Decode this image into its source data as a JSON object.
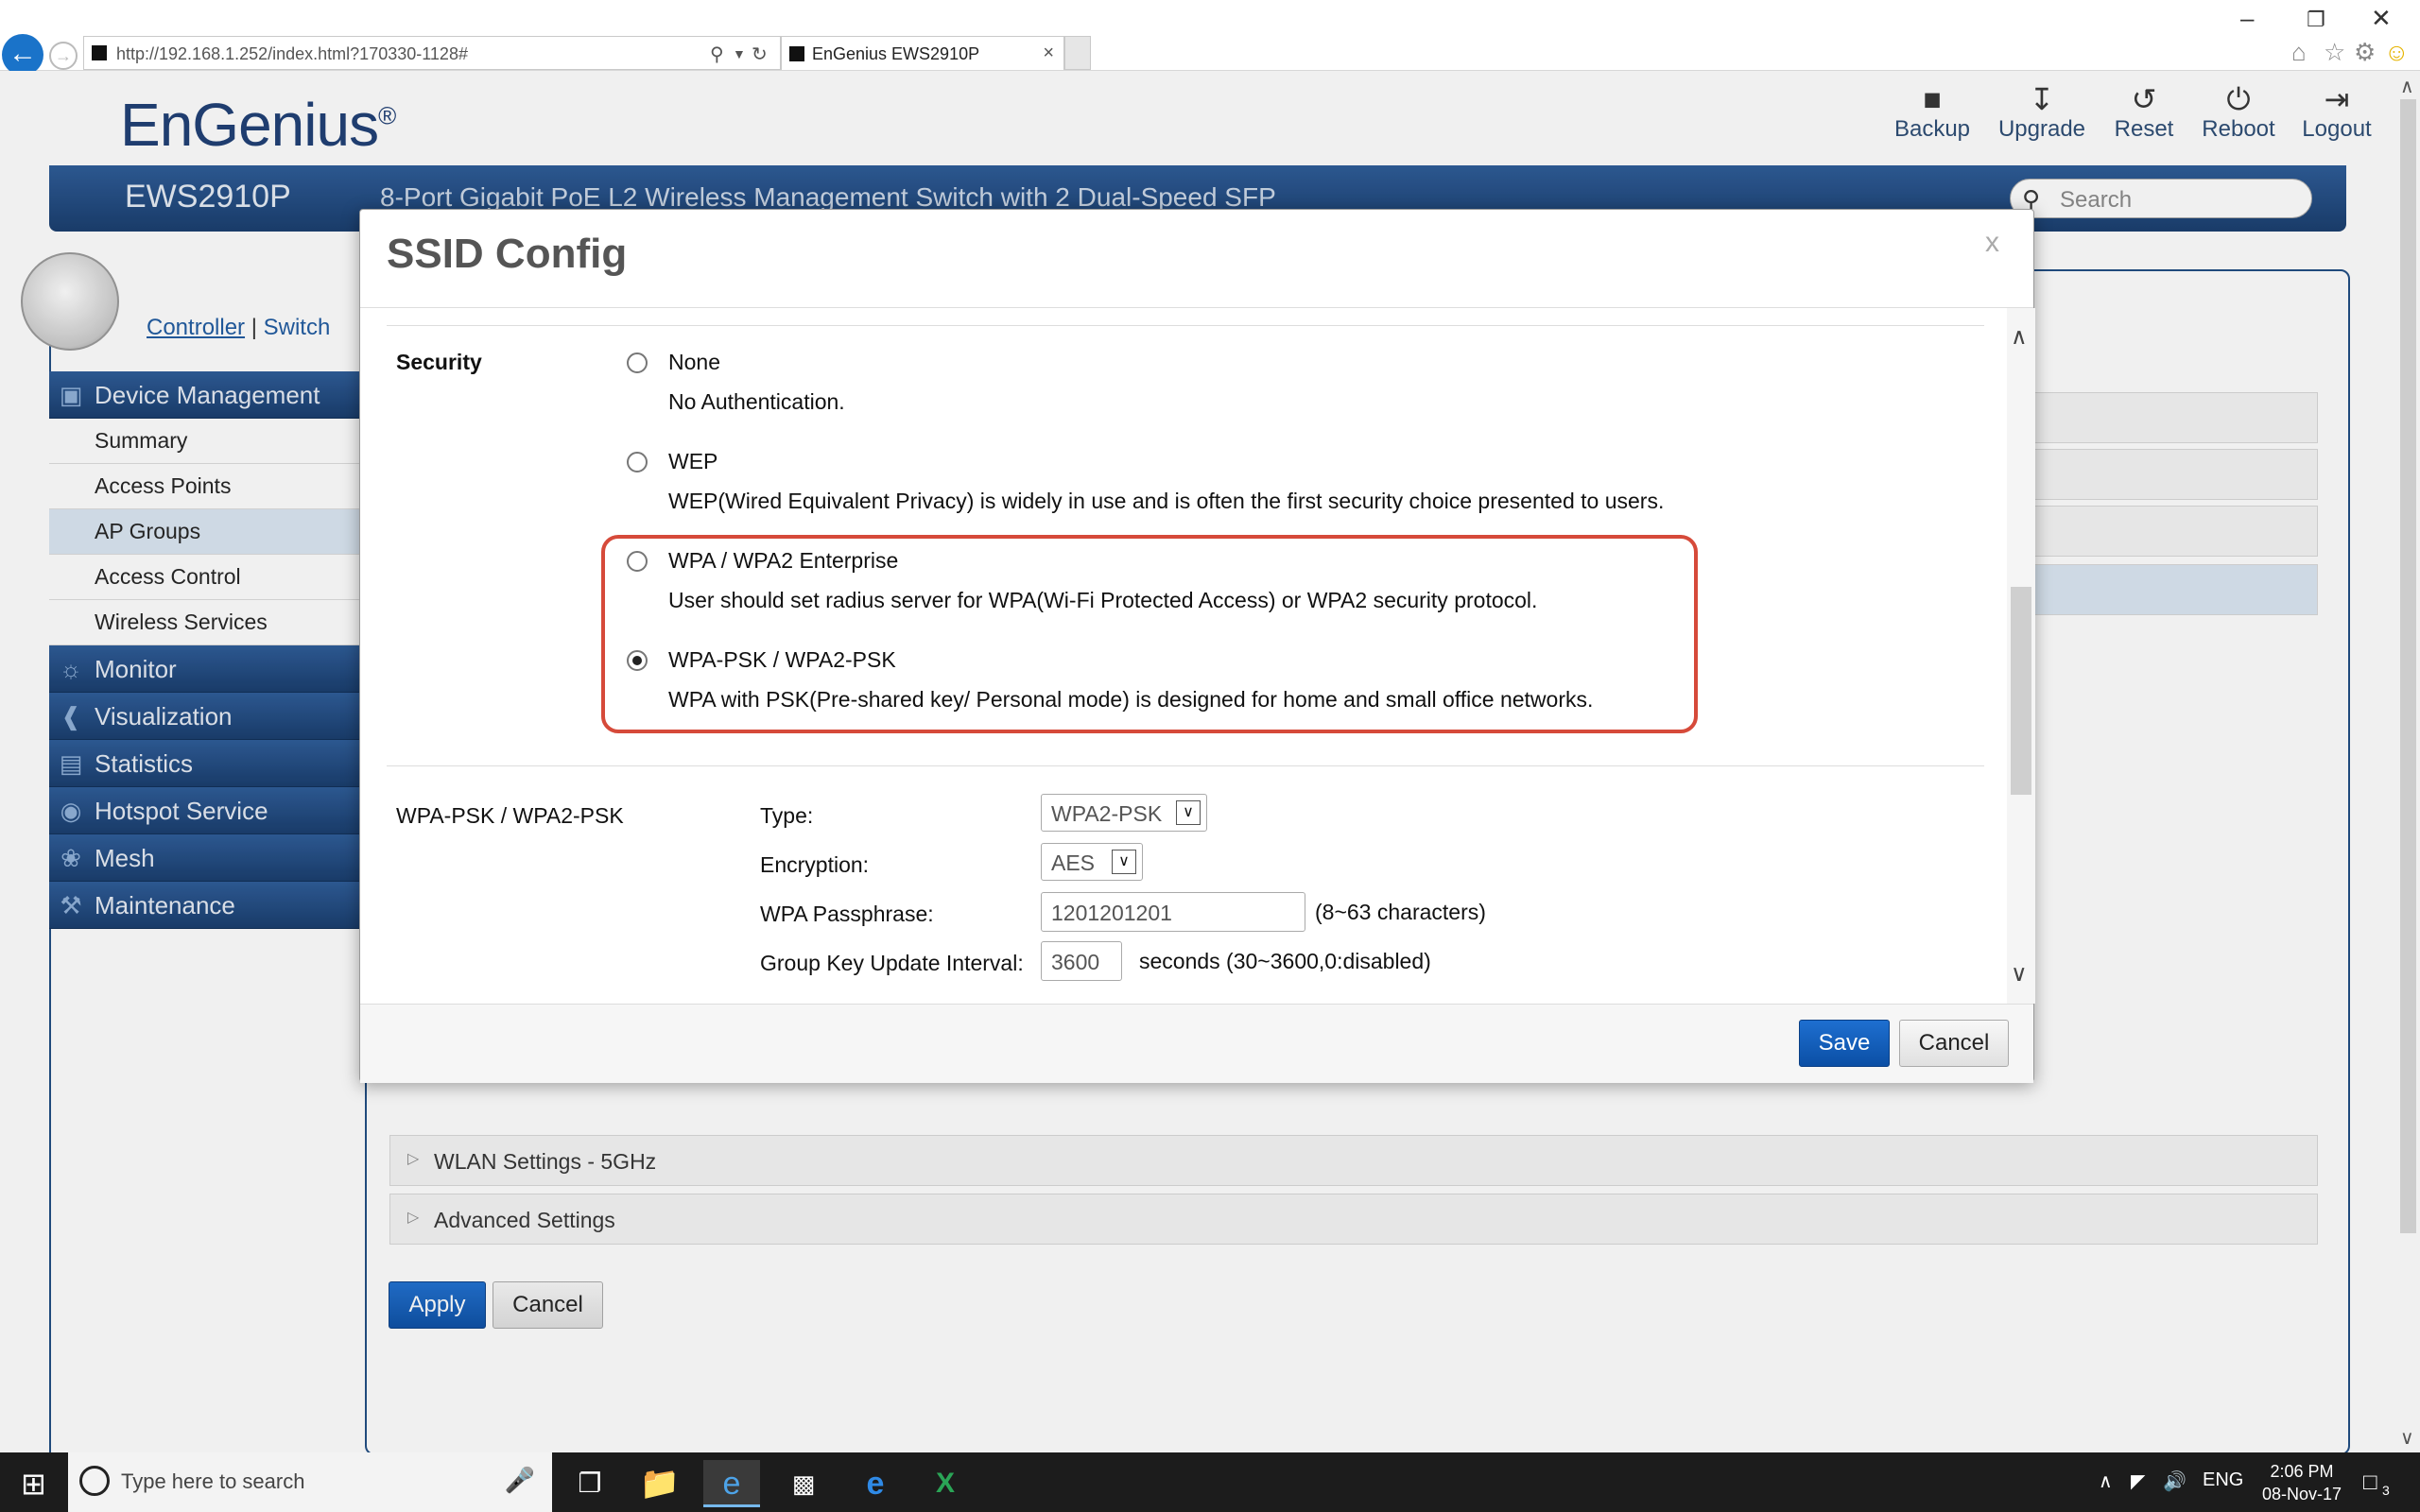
{
  "browser": {
    "url": "http://192.168.1.252/index.html?170330-1128#",
    "tab_title": "EnGenius EWS2910P"
  },
  "header": {
    "logo": "EnGenius",
    "model": "EWS2910P",
    "subtitle": "8-Port Gigabit PoE L2 Wireless Management Switch with 2 Dual-Speed SFP",
    "search_placeholder": "Search",
    "actions": [
      {
        "label": "Backup",
        "icon": "save-icon"
      },
      {
        "label": "Upgrade",
        "icon": "download-icon"
      },
      {
        "label": "Reset",
        "icon": "reset-icon"
      },
      {
        "label": "Reboot",
        "icon": "power-icon"
      },
      {
        "label": "Logout",
        "icon": "logout-icon"
      }
    ]
  },
  "sidebar": {
    "controller": "Controller",
    "sep": "|",
    "switch": "Switch",
    "sections": [
      {
        "label": "Device Management",
        "icon": "device-icon"
      },
      {
        "label": "Monitor",
        "icon": "monitor-icon"
      },
      {
        "label": "Visualization",
        "icon": "share-icon"
      },
      {
        "label": "Statistics",
        "icon": "bar-chart-icon"
      },
      {
        "label": "Hotspot Service",
        "icon": "wifi-icon"
      },
      {
        "label": "Mesh",
        "icon": "mesh-icon"
      },
      {
        "label": "Maintenance",
        "icon": "wrench-icon"
      }
    ],
    "items": [
      "Summary",
      "Access Points",
      "AP Groups",
      "Access Control",
      "Wireless Services"
    ],
    "active_item": "AP Groups"
  },
  "main": {
    "rows": [
      "WLAN Settings - 5GHz",
      "Advanced Settings"
    ],
    "apply": "Apply",
    "cancel": "Cancel"
  },
  "modal": {
    "title": "SSID Config",
    "close": "x",
    "security_label": "Security",
    "options": [
      {
        "label": "None",
        "desc": "No Authentication.",
        "selected": false
      },
      {
        "label": "WEP",
        "desc": "WEP(Wired Equivalent Privacy) is widely in use and is often the first security choice presented to users.",
        "selected": false
      },
      {
        "label": "WPA / WPA2 Enterprise",
        "desc": "User should set radius server for WPA(Wi-Fi Protected Access) or WPA2 security protocol.",
        "selected": false
      },
      {
        "label": "WPA-PSK / WPA2-PSK",
        "desc": "WPA with PSK(Pre-shared key/ Personal mode) is designed for home and small office networks.",
        "selected": true
      }
    ],
    "psk_section": "WPA-PSK / WPA2-PSK",
    "type_label": "Type:",
    "type_value": "WPA2-PSK",
    "encryption_label": "Encryption:",
    "encryption_value": "AES",
    "passphrase_label": "WPA Passphrase:",
    "passphrase_value": "1201201201",
    "passphrase_hint": "(8~63 characters)",
    "interval_label": "Group Key Update Interval:",
    "interval_value": "3600",
    "interval_hint": "seconds (30~3600,0:disabled)",
    "save": "Save",
    "cancel": "Cancel"
  },
  "taskbar": {
    "search_placeholder": "Type here to search",
    "lang": "ENG",
    "time": "2:06 PM",
    "date": "08-Nov-17",
    "notifications": "3"
  }
}
